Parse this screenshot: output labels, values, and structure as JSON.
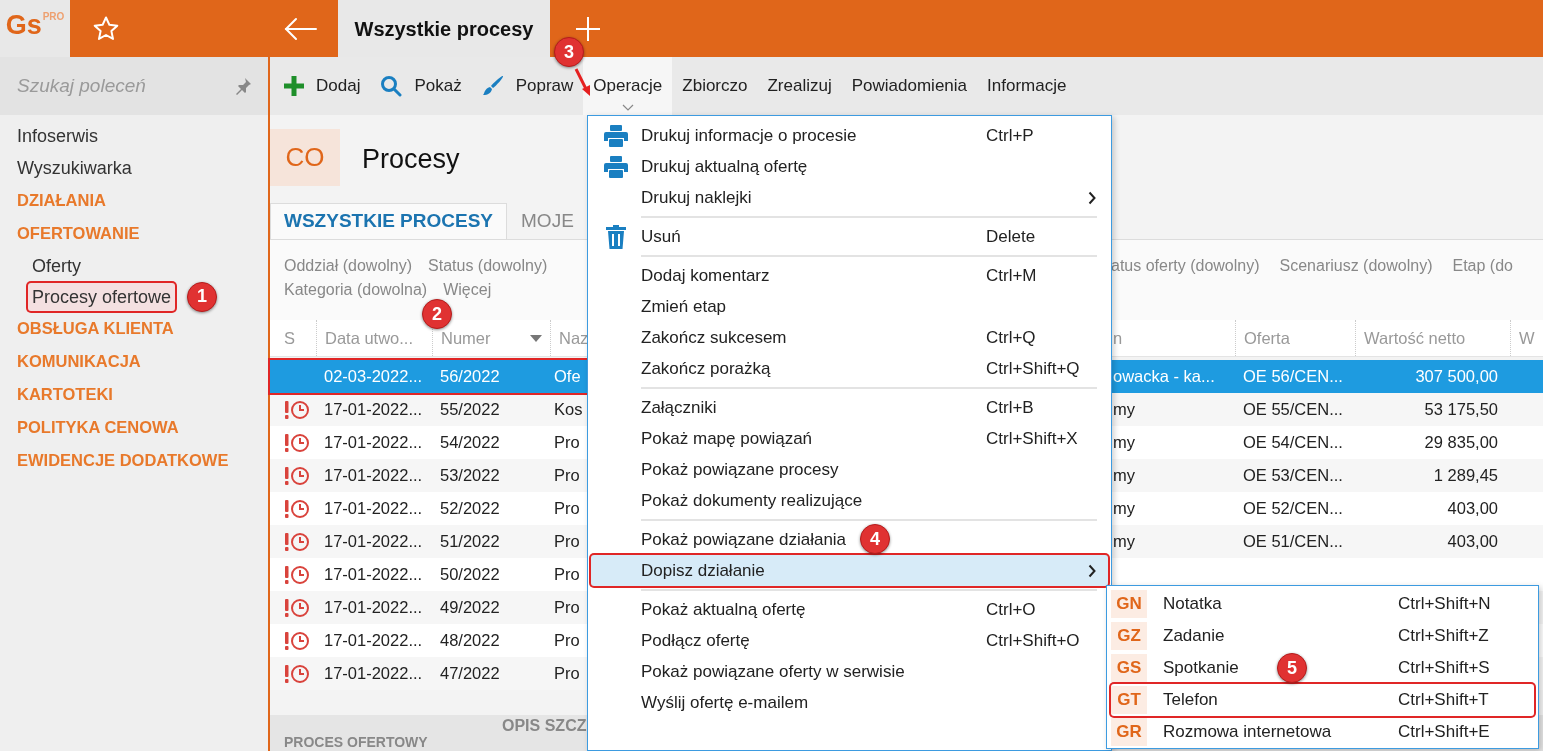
{
  "app": {
    "logo": "Gs",
    "logo_badge": "PRO"
  },
  "top_tabs": [
    {
      "label": "Wszystkie procesy",
      "selected": true
    }
  ],
  "sidebar": {
    "search": {
      "placeholder": "Szukaj poleceń"
    },
    "items": [
      {
        "kind": "link",
        "label": "Infoserwis"
      },
      {
        "kind": "link",
        "label": "Wyszukiwarka"
      },
      {
        "kind": "section",
        "label": "DZIAŁANIA"
      },
      {
        "kind": "section",
        "label": "OFERTOWANIE",
        "children": [
          {
            "label": "Oferty",
            "selected": false,
            "highlighted": false
          },
          {
            "label": "Procesy ofertowe",
            "selected": true,
            "highlighted": true,
            "callout": "1"
          }
        ]
      },
      {
        "kind": "section",
        "label": "OBSŁUGA KLIENTA"
      },
      {
        "kind": "section",
        "label": "KOMUNIKACJA"
      },
      {
        "kind": "section",
        "label": "KARTOTEKI"
      },
      {
        "kind": "section",
        "label": "POLITYKA CENOWA"
      },
      {
        "kind": "section",
        "label": "EWIDENCJE DODATKOWE"
      }
    ]
  },
  "toolbar": [
    {
      "kind": "add",
      "label": "Dodaj",
      "selected": false
    },
    {
      "kind": "find",
      "label": "Pokaż",
      "selected": false
    },
    {
      "kind": "edit",
      "label": "Popraw",
      "selected": false
    },
    {
      "kind": "plain",
      "label": "Operacje",
      "selected": true,
      "callout": "3"
    },
    {
      "kind": "plain",
      "label": "Zbiorczo",
      "selected": false
    },
    {
      "kind": "plain",
      "label": "Zrealizuj",
      "selected": false
    },
    {
      "kind": "plain",
      "label": "Powiadomienia",
      "selected": false
    },
    {
      "kind": "plain",
      "label": "Informacje",
      "selected": false
    }
  ],
  "module": {
    "code": "CO",
    "title": "Procesy"
  },
  "tabs": [
    {
      "label": "WSZYSTKIE PROCESY",
      "selected": true
    },
    {
      "label": "MOJE",
      "selected": false
    }
  ],
  "filters": [
    [
      "Oddział (dowolny)",
      "Status (dowolny)"
    ],
    [
      "Kategoria (dowolna)",
      "Więcej"
    ]
  ],
  "filters_beyond_menu": [
    "atus oferty (dowolny)",
    "Scenariusz (dowolny)",
    "Etap (do"
  ],
  "table": {
    "columns": [
      {
        "label": "S"
      },
      {
        "label": "Data utwo..."
      },
      {
        "label": "Numer",
        "sorted": true
      },
      {
        "label": "Naz"
      },
      {
        "label": "n"
      },
      {
        "label": "Oferta"
      },
      {
        "label": "Wartość netto"
      },
      {
        "label": "W"
      }
    ],
    "rows": [
      {
        "alert": false,
        "selected": true,
        "highlighted": true,
        "callout": "2",
        "cells": [
          "",
          "02-03-2022...",
          "56/2022",
          "Ofe",
          "owacka - ka...",
          "OE 56/CEN...",
          "307 500,00"
        ]
      },
      {
        "alert": true,
        "selected": false,
        "highlighted": false,
        "cells": [
          "",
          "17-01-2022...",
          "55/2022",
          "Kos",
          "my",
          "OE 55/CEN...",
          "53 175,50"
        ]
      },
      {
        "alert": true,
        "selected": false,
        "highlighted": false,
        "cells": [
          "",
          "17-01-2022...",
          "54/2022",
          "Pro",
          "my",
          "OE 54/CEN...",
          "29 835,00"
        ]
      },
      {
        "alert": true,
        "selected": false,
        "highlighted": false,
        "cells": [
          "",
          "17-01-2022...",
          "53/2022",
          "Pro",
          "my",
          "OE 53/CEN...",
          "1 289,45"
        ]
      },
      {
        "alert": true,
        "selected": false,
        "highlighted": false,
        "cells": [
          "",
          "17-01-2022...",
          "52/2022",
          "Pro",
          "my",
          "OE 52/CEN...",
          "403,00"
        ]
      },
      {
        "alert": true,
        "selected": false,
        "highlighted": false,
        "cells": [
          "",
          "17-01-2022...",
          "51/2022",
          "Pro",
          "my",
          "OE 51/CEN...",
          "403,00"
        ]
      },
      {
        "alert": true,
        "selected": false,
        "highlighted": false,
        "cells": [
          "",
          "17-01-2022...",
          "50/2022",
          "Pro"
        ]
      },
      {
        "alert": true,
        "selected": false,
        "highlighted": false,
        "cells": [
          "",
          "17-01-2022...",
          "49/2022",
          "Pro"
        ]
      },
      {
        "alert": true,
        "selected": false,
        "highlighted": false,
        "cells": [
          "",
          "17-01-2022...",
          "48/2022",
          "Pro"
        ]
      },
      {
        "alert": true,
        "selected": false,
        "highlighted": false,
        "cells": [
          "",
          "17-01-2022...",
          "47/2022",
          "Pro"
        ]
      }
    ]
  },
  "bottom": {
    "section": "PROCES OFERTOWY",
    "section_2": "OPIS SZCZ"
  },
  "menu": {
    "groups": [
      [
        {
          "kind": "print",
          "label": "Drukuj informacje o procesie",
          "shortcut": "Ctrl+P",
          "submenu": false,
          "selected": false,
          "highlighted": false
        },
        {
          "kind": "print",
          "label": "Drukuj aktualną ofertę",
          "submenu": false,
          "selected": false,
          "highlighted": false
        },
        {
          "kind": "plain",
          "label": "Drukuj naklejki",
          "submenu": true,
          "selected": false,
          "highlighted": false
        }
      ],
      [
        {
          "kind": "delete",
          "label": "Usuń",
          "shortcut": "Delete",
          "submenu": false,
          "selected": false,
          "highlighted": false
        }
      ],
      [
        {
          "kind": "plain",
          "label": "Dodaj komentarz",
          "shortcut": "Ctrl+M",
          "submenu": false,
          "selected": false,
          "highlighted": false
        },
        {
          "kind": "plain",
          "label": "Zmień etap",
          "submenu": false,
          "selected": false,
          "highlighted": false
        },
        {
          "kind": "plain",
          "label": "Zakończ sukcesem",
          "shortcut": "Ctrl+Q",
          "submenu": false,
          "selected": false,
          "highlighted": false
        },
        {
          "kind": "plain",
          "label": "Zakończ porażką",
          "shortcut": "Ctrl+Shift+Q",
          "submenu": false,
          "selected": false,
          "highlighted": false
        }
      ],
      [
        {
          "kind": "plain",
          "label": "Załączniki",
          "shortcut": "Ctrl+B",
          "submenu": false,
          "selected": false,
          "highlighted": false
        },
        {
          "kind": "plain",
          "label": "Pokaż mapę powiązań",
          "shortcut": "Ctrl+Shift+X",
          "submenu": false,
          "selected": false,
          "highlighted": false
        },
        {
          "kind": "plain",
          "label": "Pokaż powiązane procesy",
          "submenu": false,
          "selected": false,
          "highlighted": false
        },
        {
          "kind": "plain",
          "label": "Pokaż dokumenty realizujące",
          "submenu": false,
          "selected": false,
          "highlighted": false
        }
      ],
      [
        {
          "kind": "plain",
          "label": "Pokaż powiązane działania",
          "submenu": false,
          "selected": false,
          "highlighted": false
        },
        {
          "kind": "plain",
          "label": "Dopisz działanie",
          "submenu": true,
          "selected": true,
          "highlighted": true,
          "callout": "4"
        }
      ],
      [
        {
          "kind": "plain",
          "label": "Pokaż aktualną ofertę",
          "shortcut": "Ctrl+O",
          "submenu": false,
          "selected": false,
          "highlighted": false
        },
        {
          "kind": "plain",
          "label": "Podłącz ofertę",
          "shortcut": "Ctrl+Shift+O",
          "submenu": false,
          "selected": false,
          "highlighted": false
        },
        {
          "kind": "plain",
          "label": "Pokaż powiązane oferty w serwisie",
          "submenu": false,
          "selected": false,
          "highlighted": false
        },
        {
          "kind": "plain",
          "label": "Wyślij ofertę e-mailem",
          "submenu": false,
          "selected": false,
          "highlighted": false
        }
      ]
    ]
  },
  "submenu": {
    "items": [
      {
        "code": "GN",
        "label": "Notatka",
        "shortcut": "Ctrl+Shift+N",
        "highlighted": false
      },
      {
        "code": "GZ",
        "label": "Zadanie",
        "shortcut": "Ctrl+Shift+Z",
        "highlighted": false
      },
      {
        "code": "GS",
        "label": "Spotkanie",
        "shortcut": "Ctrl+Shift+S",
        "highlighted": false
      },
      {
        "code": "GT",
        "label": "Telefon",
        "shortcut": "Ctrl+Shift+T",
        "highlighted": true,
        "callout": "5"
      },
      {
        "code": "GR",
        "label": "Rozmowa internetowa",
        "shortcut": "Ctrl+Shift+E",
        "highlighted": false
      }
    ]
  }
}
